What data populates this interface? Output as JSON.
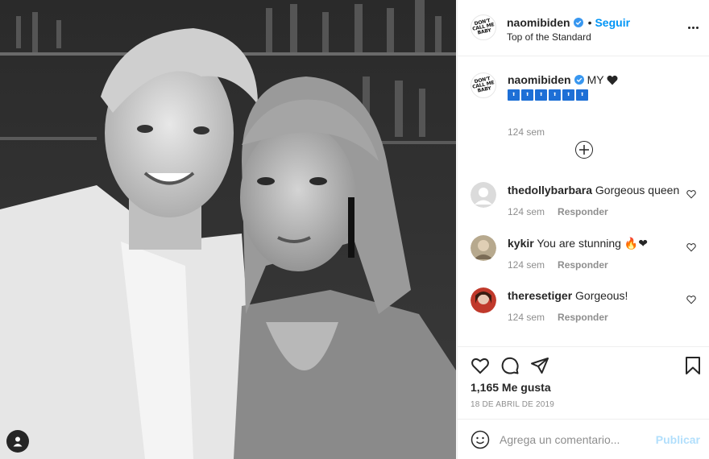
{
  "post": {
    "image_alt": "",
    "user_tags_icon": "user-tag-icon"
  },
  "header": {
    "avatar_text": "DON'T CALL ME BABY",
    "username": "naomibiden",
    "verified": true,
    "separator": "•",
    "follow_label": "Seguir",
    "location": "Top of the Standard",
    "more_icon": "more-options-icon"
  },
  "caption": {
    "avatar_text": "DON'T CALL ME BABY",
    "username": "naomibiden",
    "text": "MY",
    "emoji_heart": "black-heart",
    "emoji_row": [
      "⬆",
      "⬆",
      "⬆",
      "⬆",
      "⬆",
      "⬆"
    ],
    "time": "124 sem"
  },
  "load_more_icon": "plus-circle-icon",
  "comments": [
    {
      "username": "thedollybarbara",
      "text": "Gorgeous queen",
      "time": "124 sem",
      "reply": "Responder"
    },
    {
      "username": "kykir",
      "text": "You are stunning 🔥❤",
      "time": "124 sem",
      "reply": "Responder"
    },
    {
      "username": "theresetiger",
      "text": "Gorgeous!",
      "time": "124 sem",
      "reply": "Responder"
    }
  ],
  "actions": {
    "like_icon": "heart-icon",
    "comment_icon": "comment-icon",
    "share_icon": "share-icon",
    "save_icon": "bookmark-icon"
  },
  "likes": "1,165 Me gusta",
  "date": "18 DE ABRIL DE 2019",
  "comment_box": {
    "placeholder": "Agrega un comentario...",
    "post_label": "Publicar",
    "emoji_icon": "smiley-icon"
  },
  "colors": {
    "accent": "#0095f6",
    "post_disabled": "#b2dffc",
    "muted": "#8e8e8e",
    "text": "#262626"
  }
}
